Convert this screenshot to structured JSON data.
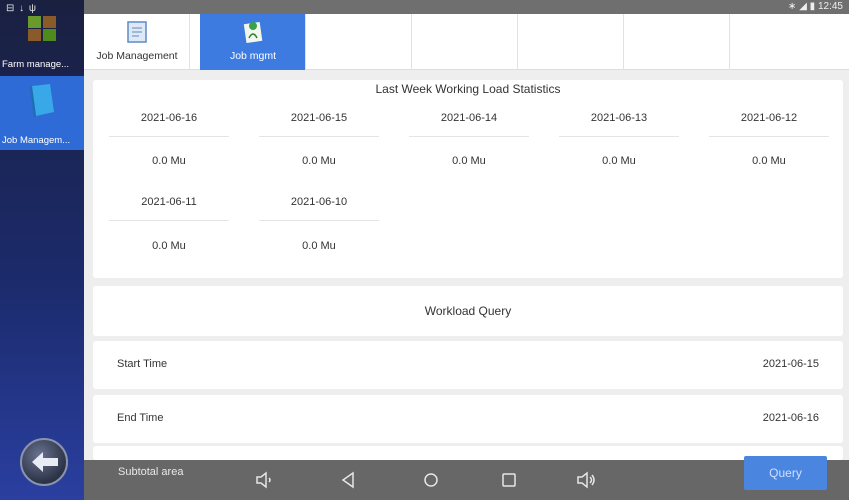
{
  "status_bar": {
    "time": "12:45",
    "icons_left": "⊟ ↓ ψ"
  },
  "sidebar": {
    "apps": [
      {
        "label": "Farm manage...",
        "icon": "farm-icon",
        "active": false
      },
      {
        "label": "Job Managem...",
        "icon": "book-icon",
        "active": true
      }
    ]
  },
  "tabs": [
    {
      "label": "Job Management",
      "icon": "document-icon",
      "active": false
    },
    {
      "label": "Job mgmt",
      "icon": "plant-doc-icon",
      "active": true
    }
  ],
  "stats": {
    "title": "Last Week Working Load Statistics",
    "items": [
      {
        "date": "2021-06-16",
        "value": "0.0 Mu"
      },
      {
        "date": "2021-06-15",
        "value": "0.0 Mu"
      },
      {
        "date": "2021-06-14",
        "value": "0.0 Mu"
      },
      {
        "date": "2021-06-13",
        "value": "0.0 Mu"
      },
      {
        "date": "2021-06-12",
        "value": "0.0 Mu"
      },
      {
        "date": "2021-06-11",
        "value": "0.0 Mu"
      },
      {
        "date": "2021-06-10",
        "value": "0.0 Mu"
      }
    ]
  },
  "query": {
    "title": "Workload Query",
    "start_label": "Start Time",
    "start_value": "2021-06-15",
    "end_label": "End Time",
    "end_value": "2021-06-16",
    "subtotal_label": "Subtotal area",
    "button_label": "Query"
  },
  "colors": {
    "accent": "#3d7be0",
    "sidebar": "#1b2a6a"
  }
}
